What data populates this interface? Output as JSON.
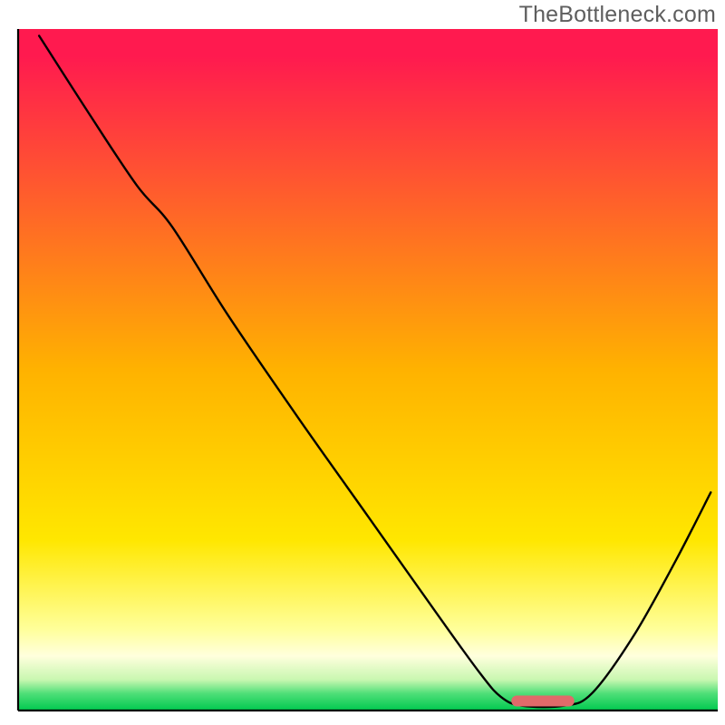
{
  "watermark": "TheBottleneck.com",
  "chart_data": {
    "type": "line",
    "title": "",
    "xlabel": "",
    "ylabel": "",
    "xlim": [
      0,
      100
    ],
    "ylim": [
      0,
      100
    ],
    "background_gradient": {
      "stops": [
        {
          "offset": 0.0,
          "color": "#ff1a4f"
        },
        {
          "offset": 0.04,
          "color": "#ff1a4f"
        },
        {
          "offset": 0.5,
          "color": "#ffb200"
        },
        {
          "offset": 0.75,
          "color": "#ffe700"
        },
        {
          "offset": 0.88,
          "color": "#ffff99"
        },
        {
          "offset": 0.92,
          "color": "#ffffdd"
        },
        {
          "offset": 0.955,
          "color": "#c8f7b0"
        },
        {
          "offset": 0.975,
          "color": "#4fdf78"
        },
        {
          "offset": 1.0,
          "color": "#00c94f"
        }
      ]
    },
    "series": [
      {
        "name": "bottleneck-curve",
        "color": "#000000",
        "width": 2.4,
        "points": [
          {
            "x": 3.0,
            "y": 99.0
          },
          {
            "x": 10.0,
            "y": 87.8
          },
          {
            "x": 17.0,
            "y": 77.0
          },
          {
            "x": 22.0,
            "y": 71.0
          },
          {
            "x": 30.0,
            "y": 58.0
          },
          {
            "x": 40.0,
            "y": 43.0
          },
          {
            "x": 50.0,
            "y": 28.5
          },
          {
            "x": 60.0,
            "y": 14.0
          },
          {
            "x": 66.0,
            "y": 5.5
          },
          {
            "x": 69.0,
            "y": 2.0
          },
          {
            "x": 72.0,
            "y": 0.7
          },
          {
            "x": 78.0,
            "y": 0.7
          },
          {
            "x": 82.0,
            "y": 2.5
          },
          {
            "x": 88.0,
            "y": 11.0
          },
          {
            "x": 94.0,
            "y": 22.0
          },
          {
            "x": 99.0,
            "y": 32.0
          }
        ]
      }
    ],
    "marker": {
      "name": "optimal-range",
      "color": "#e06a6a",
      "x_center": 75.0,
      "y": 1.4,
      "width": 9.0,
      "height": 1.6,
      "rx": 0.8
    },
    "axis": {
      "color": "#000000",
      "width": 2.2
    }
  }
}
